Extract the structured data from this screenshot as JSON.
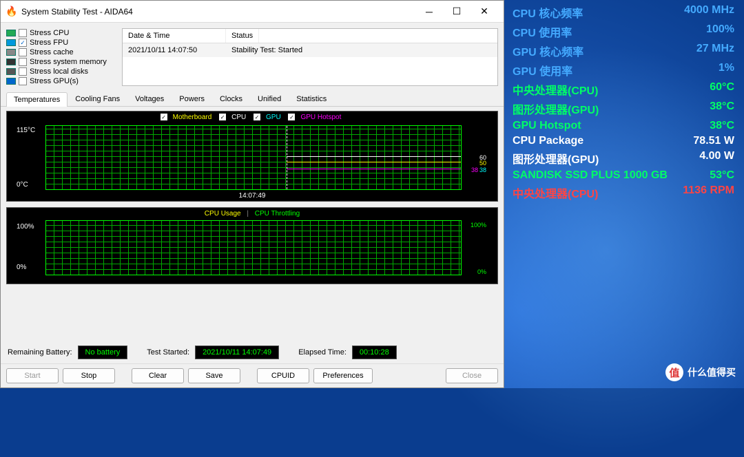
{
  "window": {
    "title": "System Stability Test - AIDA64",
    "icon": "🔥"
  },
  "stress_options": [
    {
      "icon": "cpu",
      "label": "Stress CPU",
      "checked": false
    },
    {
      "icon": "fpu",
      "label": "Stress FPU",
      "checked": true
    },
    {
      "icon": "cache",
      "label": "Stress cache",
      "checked": false
    },
    {
      "icon": "mem",
      "label": "Stress system memory",
      "checked": false
    },
    {
      "icon": "disk",
      "label": "Stress local disks",
      "checked": false
    },
    {
      "icon": "gpu",
      "label": "Stress GPU(s)",
      "checked": false
    }
  ],
  "log": {
    "headers": [
      "Date & Time",
      "Status"
    ],
    "rows": [
      {
        "datetime": "2021/10/11 14:07:50",
        "status": "Stability Test: Started"
      }
    ]
  },
  "tabs": [
    "Temperatures",
    "Cooling Fans",
    "Voltages",
    "Powers",
    "Clocks",
    "Unified",
    "Statistics"
  ],
  "active_tab": 0,
  "chart_data": [
    {
      "type": "line",
      "title": "Temperatures",
      "ylabel": "°C",
      "ylim": [
        0,
        115
      ],
      "y_top": "115°C",
      "y_bot": "0°C",
      "x_marker": "14:07:49",
      "legend": [
        {
          "name": "Motherboard",
          "color": "#ff0"
        },
        {
          "name": "CPU",
          "color": "#fff"
        },
        {
          "name": "GPU",
          "color": "#0ff"
        },
        {
          "name": "GPU Hotspot",
          "color": "#f0f"
        }
      ],
      "series": [
        {
          "name": "Motherboard",
          "end_value": 50
        },
        {
          "name": "CPU",
          "end_value": 60
        },
        {
          "name": "GPU",
          "end_value": 38
        },
        {
          "name": "GPU Hotspot",
          "end_value": 38
        }
      ],
      "right_labels": [
        {
          "text": "60",
          "color": "#fff",
          "pos": 60
        },
        {
          "text": "50",
          "color": "#ff0",
          "pos": 50
        },
        {
          "text": "38",
          "color": "#0ff",
          "pos": 38
        },
        {
          "text": "38",
          "color": "#f0f",
          "pos": 38
        }
      ]
    },
    {
      "type": "line",
      "title": "Usage",
      "ylim": [
        0,
        100
      ],
      "y_top": "100%",
      "y_bot": "0%",
      "r_top": "100%",
      "r_bot": "0%",
      "legend_usage": "CPU Usage",
      "legend_throttle": "CPU Throttling",
      "series": [
        {
          "name": "CPU Usage",
          "value": 100
        },
        {
          "name": "CPU Throttling",
          "value": 0
        }
      ]
    }
  ],
  "status": {
    "battery_label": "Remaining Battery:",
    "battery_val": "No battery",
    "started_label": "Test Started:",
    "started_val": "2021/10/11 14:07:49",
    "elapsed_label": "Elapsed Time:",
    "elapsed_val": "00:10:28"
  },
  "buttons": {
    "start": "Start",
    "stop": "Stop",
    "clear": "Clear",
    "save": "Save",
    "cpuid": "CPUID",
    "prefs": "Preferences",
    "close": "Close"
  },
  "osd": [
    {
      "label": "CPU 核心频率",
      "value": "4000 MHz",
      "cls": "c-blue"
    },
    {
      "label": "CPU 使用率",
      "value": "100%",
      "cls": "c-blue"
    },
    {
      "label": "GPU 核心频率",
      "value": "27 MHz",
      "cls": "c-blue"
    },
    {
      "label": "GPU 使用率",
      "value": "1%",
      "cls": "c-blue"
    },
    {
      "label": "中央处理器(CPU)",
      "value": "60°C",
      "cls": "c-green"
    },
    {
      "label": "图形处理器(GPU)",
      "value": "38°C",
      "cls": "c-green"
    },
    {
      "label": "GPU Hotspot",
      "value": "38°C",
      "cls": "c-green"
    },
    {
      "label": "CPU Package",
      "value": "78.51 W",
      "cls": "c-white"
    },
    {
      "label": "图形处理器(GPU)",
      "value": "4.00 W",
      "cls": "c-white"
    },
    {
      "label": "SANDISK SSD PLUS 1000 GB",
      "value": "53°C",
      "cls": "c-green"
    },
    {
      "label": "中央处理器(CPU)",
      "value": "1136 RPM",
      "cls": "c-red"
    }
  ],
  "watermark": {
    "icon": "值",
    "text": "什么值得买"
  }
}
